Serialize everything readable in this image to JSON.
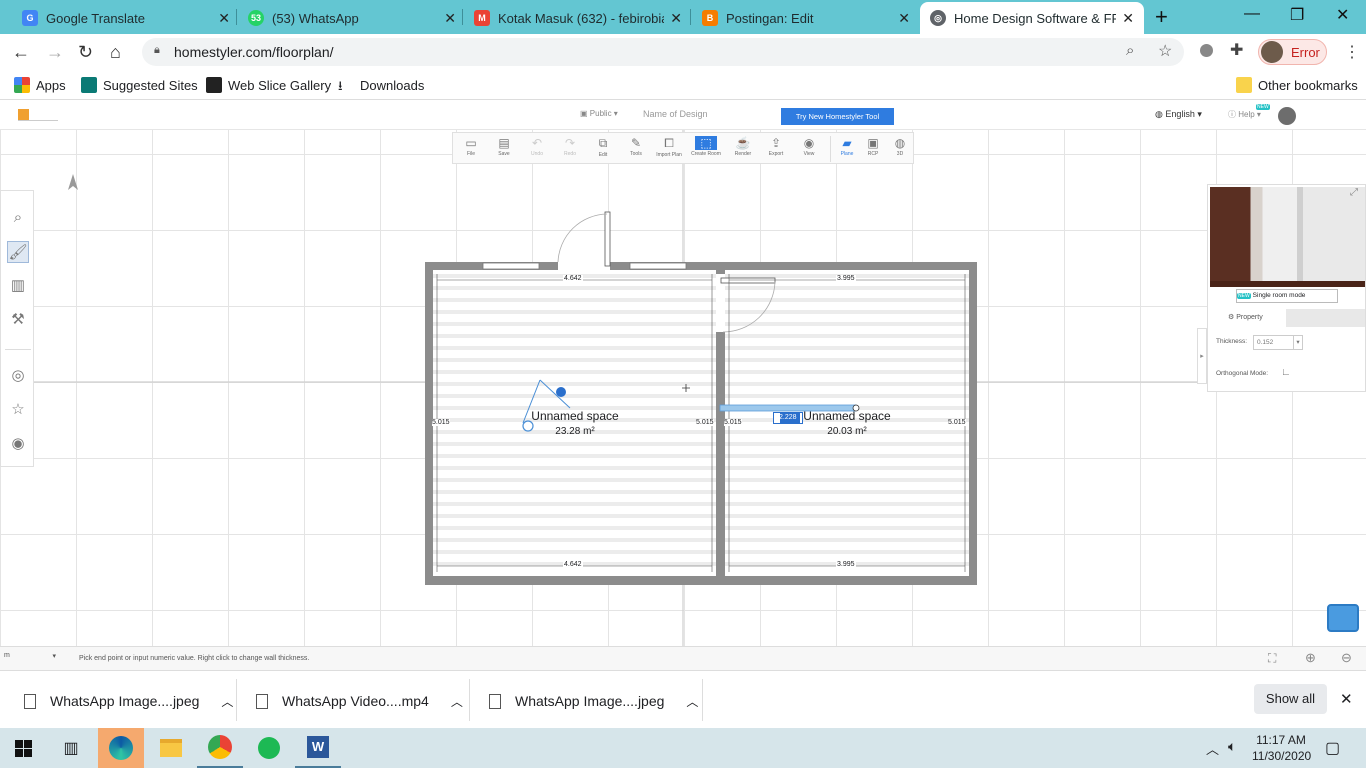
{
  "tabs": [
    {
      "title": "Google Translate",
      "icon": "google-translate-icon",
      "favtext": "G",
      "color": "#4285f4"
    },
    {
      "title": "(53) WhatsApp",
      "icon": "whatsapp-icon",
      "favtext": "53",
      "color": "#25d366"
    },
    {
      "title": "Kotak Masuk (632) - febirobiant",
      "icon": "gmail-icon",
      "favtext": "M",
      "color": "#ea4335"
    },
    {
      "title": "Postingan: Edit",
      "icon": "blogger-icon",
      "favtext": "B",
      "color": "#f57d00"
    },
    {
      "title": "Home Design Software & FREE",
      "icon": "globe-icon",
      "favtext": "◎",
      "color": "#5f6368"
    }
  ],
  "address": {
    "url": "homestyler.com/floorplan/",
    "profile_label": "Error"
  },
  "bookmarks": [
    {
      "label": "Apps",
      "icon": "apps-grid-icon",
      "color": "#e94235"
    },
    {
      "label": "Suggested Sites",
      "icon": "bing-icon",
      "color": "#0b7a75"
    },
    {
      "label": "Web Slice Gallery",
      "icon": "web-slice-icon",
      "color": "#222"
    },
    {
      "label": "Downloads",
      "icon": "download-icon",
      "color": "#333"
    }
  ],
  "other_bookmarks": "Other bookmarks",
  "app_header": {
    "visibility": "Public",
    "design_name_placeholder": "Name of Design",
    "try_new": "Try New Homestyler Tool",
    "language": "English",
    "help": "Help",
    "new_badge": "NEW"
  },
  "toolbar": [
    {
      "label": "File",
      "icon": "file-icon",
      "g": "▭"
    },
    {
      "label": "Save",
      "icon": "save-icon",
      "g": "▤"
    },
    {
      "label": "Undo",
      "icon": "undo-icon",
      "g": "↶"
    },
    {
      "label": "Redo",
      "icon": "redo-icon",
      "g": "↷"
    },
    {
      "label": "Edit",
      "icon": "edit-icon",
      "g": "⧉"
    },
    {
      "label": "Tools",
      "icon": "tools-icon",
      "g": "✎"
    },
    {
      "label": "Import Plan",
      "icon": "import-plan-icon",
      "g": "⧠"
    },
    {
      "label": "Create Room",
      "icon": "create-room-icon",
      "g": "⬚"
    },
    {
      "label": "Render",
      "icon": "render-icon",
      "g": "☕"
    },
    {
      "label": "Export",
      "icon": "export-icon",
      "g": "⇪"
    },
    {
      "label": "View",
      "icon": "view-icon",
      "g": "◉"
    },
    {
      "label": "Plane",
      "icon": "plane-view-icon",
      "g": "▰"
    },
    {
      "label": "RCP",
      "icon": "rcp-icon",
      "g": "▣"
    },
    {
      "label": "3D",
      "icon": "3d-view-icon",
      "g": "◍"
    }
  ],
  "floorplan": {
    "rooms": [
      {
        "name": "Unnamed space",
        "area": "23.28 m²"
      },
      {
        "name": "Unnamed space",
        "area": "20.03 m²"
      }
    ],
    "dimensions": {
      "top_left": "4.642",
      "top_right": "3.995",
      "bottom_left": "4.642",
      "bottom_right": "3.995",
      "left": "5.015",
      "mid_left": "5.015",
      "mid_right": "5.015",
      "right": "5.015"
    },
    "wall_input": "2.228"
  },
  "right_panel": {
    "single_room_mode": "Single room mode",
    "new_badge": "NEW",
    "property_tab": "Property",
    "thickness_label": "Thickness:",
    "thickness_value": "0.152",
    "orthogonal_label": "Orthogonal Mode:"
  },
  "status": {
    "unit": "m",
    "hint": "Pick end point or input numeric value. Right click to change wall thickness."
  },
  "downloads": [
    {
      "name": "WhatsApp Image....jpeg"
    },
    {
      "name": "WhatsApp Video....mp4"
    },
    {
      "name": "WhatsApp Image....jpeg"
    }
  ],
  "show_all": "Show all",
  "clock": {
    "time": "11:17 AM",
    "date": "11/30/2020"
  }
}
